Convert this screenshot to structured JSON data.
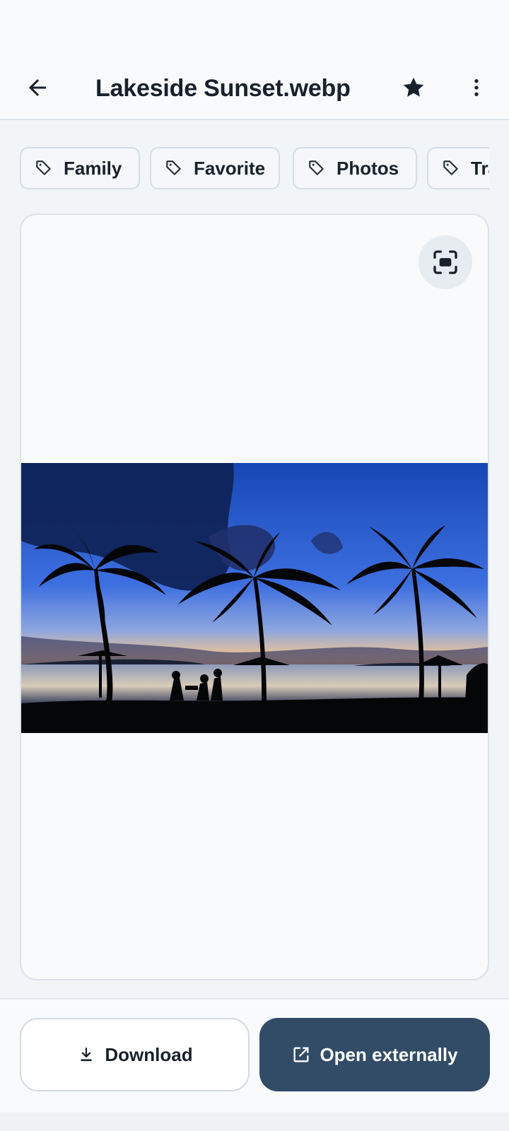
{
  "header": {
    "title": "Lakeside Sunset.webp",
    "back_icon": "arrow-left-icon",
    "favorite_icon": "star-icon",
    "more_icon": "more-vertical-icon"
  },
  "tags": [
    {
      "label": "Family",
      "icon": "tag-icon"
    },
    {
      "label": "Favorite",
      "icon": "tag-icon"
    },
    {
      "label": "Photos",
      "icon": "tag-icon"
    },
    {
      "label": "Travel",
      "icon": "tag-icon"
    }
  ],
  "preview": {
    "fit_icon": "fit-screen-icon",
    "image_description": "sunset-palm-silhouette"
  },
  "actions": {
    "download_label": "Download",
    "download_icon": "download-icon",
    "open_label": "Open externally",
    "open_icon": "open-in-new-icon"
  },
  "colors": {
    "primary": "#324c68",
    "background": "#f1f5f8",
    "surface": "#f8fafc",
    "text": "#18212b"
  }
}
